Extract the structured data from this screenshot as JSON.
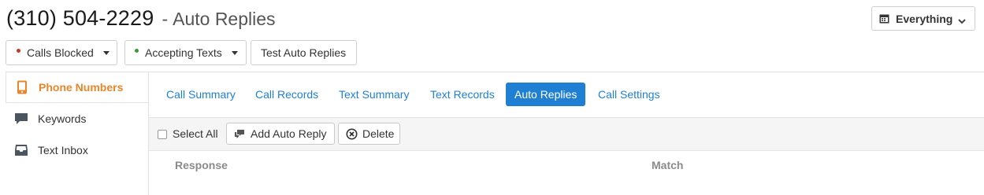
{
  "header": {
    "phone": "(310) 504-2229",
    "separator": "-",
    "title": "Auto Replies"
  },
  "range_selector": {
    "label": "Everything",
    "icon": "calendar-icon"
  },
  "actions": {
    "calls_blocked": {
      "label": "Calls Blocked",
      "status_color": "#c0392b"
    },
    "accepting_texts": {
      "label": "Accepting Texts",
      "status_color": "#3a9a3a"
    },
    "test_auto_replies": {
      "label": "Test Auto Replies"
    }
  },
  "sidebar": {
    "items": [
      {
        "label": "Phone Numbers",
        "icon": "phone-icon",
        "active": true
      },
      {
        "label": "Keywords",
        "icon": "chat-bubble-icon",
        "active": false
      },
      {
        "label": "Text Inbox",
        "icon": "inbox-tray-icon",
        "active": false
      }
    ]
  },
  "tabs": [
    {
      "label": "Call Summary"
    },
    {
      "label": "Call Records"
    },
    {
      "label": "Text Summary"
    },
    {
      "label": "Text Records"
    },
    {
      "label": "Auto Replies",
      "active": true
    },
    {
      "label": "Call Settings"
    }
  ],
  "toolbar": {
    "select_all_label": "Select All",
    "select_all_checked": false,
    "add_label": "Add Auto Reply",
    "delete_label": "Delete"
  },
  "table": {
    "columns": [
      "Response",
      "Match"
    ]
  },
  "colors": {
    "accent_blue": "#1f7fd3",
    "accent_orange": "#e8862a"
  }
}
